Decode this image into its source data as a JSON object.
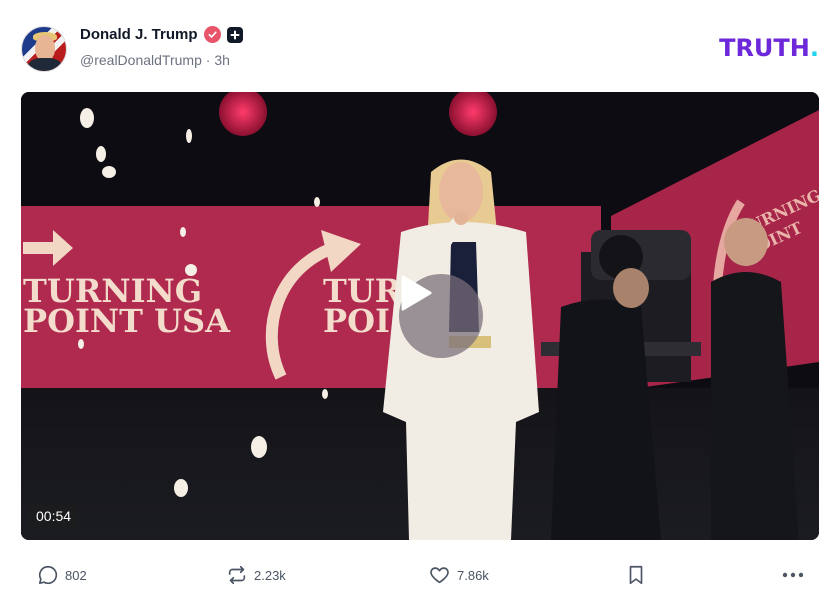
{
  "post": {
    "author_name": "Donald J. Trump",
    "handle": "@realDonaldTrump",
    "separator": "·",
    "time_ago": "3h"
  },
  "brand": {
    "logo_text": "TRUTH",
    "logo_dot": ".",
    "logo_color": "#6d28d9",
    "dot_color": "#22d3ee"
  },
  "video": {
    "duration": "00:54",
    "banner_text_left_line1": "TURNING",
    "banner_text_left_line2": "POINT USA",
    "banner_text_mid_line1": "TUR",
    "banner_text_mid_line2": "POI",
    "banner_text_right_line1": "TURNING",
    "banner_text_right_line2": "POINT"
  },
  "actions": {
    "replies": "802",
    "retruths": "2.23k",
    "likes": "7.86k"
  },
  "icons": {
    "verified": "verified-badge-icon",
    "plus": "plus-badge-icon",
    "reply": "comment-icon",
    "retruth": "repost-icon",
    "like": "heart-icon",
    "bookmark": "bookmark-icon",
    "more": "more-icon",
    "play": "play-icon"
  },
  "colors": {
    "verified_badge": "#e8546a",
    "banner": "#b0294e",
    "text_muted": "#6b7280"
  }
}
